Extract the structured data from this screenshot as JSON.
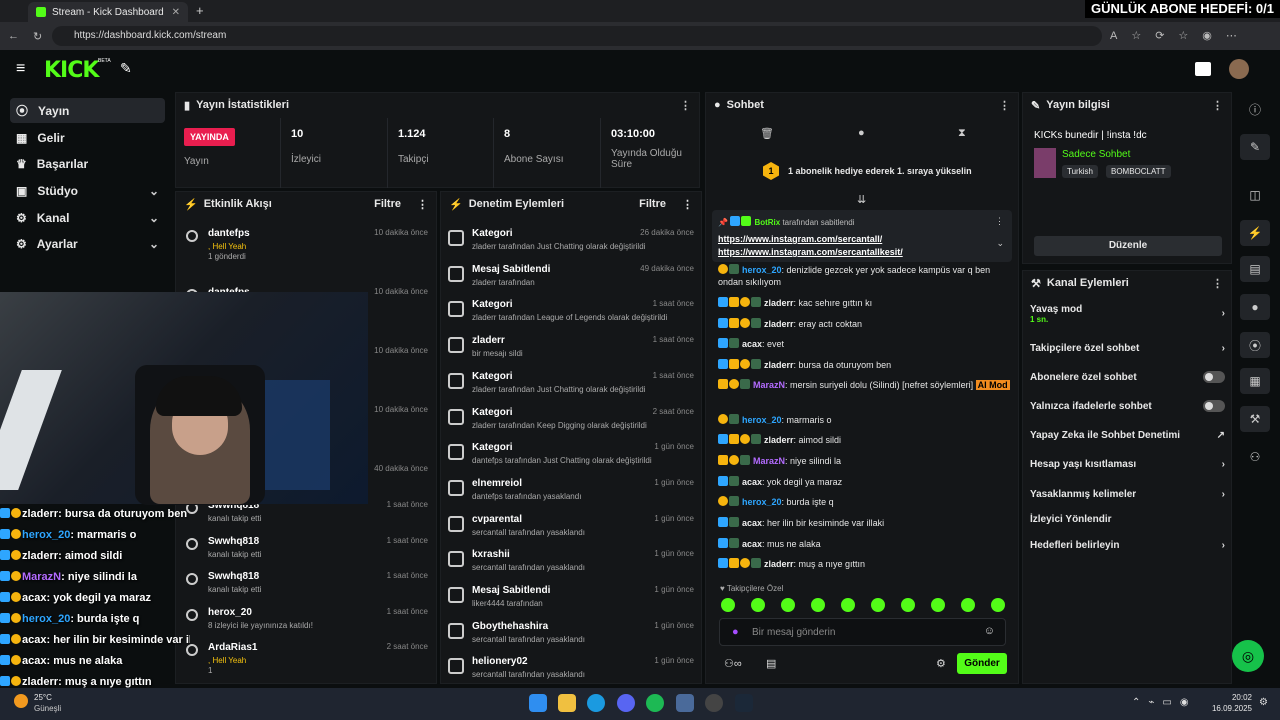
{
  "browser": {
    "tab_title": "Stream - Kick Dashboard",
    "url": "https://dashboard.kick.com/stream"
  },
  "overlay_goal": "GÜNLÜK ABONE HEDEFİ: 0/1",
  "brand": {
    "logo": "KICK",
    "beta": "BETA",
    "green": "#53fc18"
  },
  "sidebar": [
    {
      "label": "Yayın",
      "icon": "broadcast-icon"
    },
    {
      "label": "Gelir",
      "icon": "money-icon"
    },
    {
      "label": "Başarılar",
      "icon": "trophy-icon"
    },
    {
      "label": "Stüdyo",
      "icon": "studio-icon"
    },
    {
      "label": "Kanal",
      "icon": "gear-icon"
    },
    {
      "label": "Ayarlar",
      "icon": "gear-icon"
    }
  ],
  "stats": {
    "title": "Yayın İstatistikleri",
    "live_badge": "YAYINDA",
    "live_label": "Yayın",
    "cells": [
      {
        "value": "10",
        "label": "İzleyici"
      },
      {
        "value": "1.124",
        "label": "Takipçi"
      },
      {
        "value": "8",
        "label": "Abone Sayısı"
      },
      {
        "value": "03:10:00",
        "label": "Yayında Olduğu Süre"
      }
    ]
  },
  "activity": {
    "title": "Etkinlik Akışı",
    "filter": "Filtre",
    "items": [
      {
        "name": "dantefps",
        "sub": ", Hell Yeah",
        "extra": "1 gönderdi",
        "time": "10 dakika önce"
      },
      {
        "name": "dantefps",
        "sub": "",
        "extra": "",
        "time": "10 dakika önce"
      },
      {
        "name": "",
        "sub": "",
        "extra": "",
        "time": "10 dakika önce"
      },
      {
        "name": "",
        "sub": "",
        "extra": "",
        "time": "10 dakika önce"
      },
      {
        "name": "",
        "sub": "",
        "extra": "",
        "time": "40 dakika önce"
      },
      {
        "name": "Swwhq818",
        "sub": "kanalı takip etti",
        "extra": "",
        "time": "1 saat önce"
      },
      {
        "name": "Swwhq818",
        "sub": "kanalı takip etti",
        "extra": "",
        "time": "1 saat önce"
      },
      {
        "name": "Swwhq818",
        "sub": "kanalı takip etti",
        "extra": "",
        "time": "1 saat önce"
      },
      {
        "name": "herox_20",
        "sub": "8 izleyici ile yayınınıza katıldı!",
        "extra": "",
        "time": "1 saat önce"
      },
      {
        "name": "ArdaRias1",
        "sub": ", Hell Yeah",
        "extra": "1",
        "time": "2 saat önce"
      }
    ]
  },
  "moderation": {
    "title": "Denetim Eylemleri",
    "filter": "Filtre",
    "items": [
      {
        "title": "Kategori",
        "sub": "zladerr tarafından Just Chatting olarak değiştirildi",
        "time": "26 dakika önce"
      },
      {
        "title": "Mesaj Sabitlendi",
        "sub": "zladerr tarafından",
        "time": "49 dakika önce"
      },
      {
        "title": "Kategori",
        "sub": "zladerr tarafından League of Legends olarak değiştirildi",
        "time": "1 saat önce"
      },
      {
        "title": "zladerr",
        "sub": "bir mesajı sildi",
        "time": "1 saat önce"
      },
      {
        "title": "Kategori",
        "sub": "zladerr tarafından Just Chatting olarak değiştirildi",
        "time": "1 saat önce"
      },
      {
        "title": "Kategori",
        "sub": "zladerr tarafından Keep Digging olarak değiştirildi",
        "time": "2 saat önce"
      },
      {
        "title": "Kategori",
        "sub": "dantefps tarafından Just Chatting olarak değiştirildi",
        "time": "1 gün önce"
      },
      {
        "title": "elnemreiol",
        "sub": "dantefps tarafından yasaklandı",
        "time": "1 gün önce"
      },
      {
        "title": "cvparental",
        "sub": "sercantall tarafından yasaklandı",
        "time": "1 gün önce"
      },
      {
        "title": "kxrashii",
        "sub": "sercantall tarafından yasaklandı",
        "time": "1 gün önce"
      },
      {
        "title": "Mesaj Sabitlendi",
        "sub": "liker4444 tarafından",
        "time": "1 gün önce"
      },
      {
        "title": "Gboythehashira",
        "sub": "sercantall tarafından yasaklandı",
        "time": "1 gün önce"
      },
      {
        "title": "helionery02",
        "sub": "sercantall tarafından yasaklandı",
        "time": "1 gün önce"
      }
    ]
  },
  "chat": {
    "title": "Sohbet",
    "gift_banner": "1 abonelik hediye ederek 1. sıraya yükselin",
    "gift_count": "1",
    "pinned": {
      "by": "BotRix",
      "suffix": "tarafından sabitlendi",
      "links": [
        "https://www.instagram.com/sercantall/",
        "https://www.instagram.com/sercantallkesit/"
      ]
    },
    "messages": [
      {
        "user": "herox_20",
        "color": "#2ea6ff",
        "text": "denizlide gezcek yer yok sadece kampüs var q ben ondan sıkılıyom",
        "badges": [
          "sub"
        ]
      },
      {
        "user": "zladerr",
        "color": "#f0f0f0",
        "text": "kac sehıre gıttın kı",
        "badges": [
          "mod",
          "crown",
          "sub"
        ]
      },
      {
        "user": "zladerr",
        "color": "#f0f0f0",
        "text": "eray actı coktan",
        "badges": [
          "mod",
          "crown",
          "sub"
        ]
      },
      {
        "user": "acax",
        "color": "#f0f0f0",
        "text": "evet",
        "badges": [
          "mod"
        ]
      },
      {
        "user": "zladerr",
        "color": "#f0f0f0",
        "text": "bursa da oturuyom ben",
        "badges": [
          "mod",
          "crown",
          "sub"
        ]
      },
      {
        "user": "MarazN",
        "color": "#b36bff",
        "text": "mersin suriyeli dolu (Silindi) [nefret söylemleri]",
        "badges": [
          "crown",
          "sub"
        ],
        "automod": "AI Mod"
      },
      {
        "user": "herox_20",
        "color": "#2ea6ff",
        "text": "marmaris o",
        "badges": [
          "sub"
        ]
      },
      {
        "user": "zladerr",
        "color": "#f0f0f0",
        "text": "aimod sildi",
        "badges": [
          "mod",
          "crown",
          "sub"
        ]
      },
      {
        "user": "MarazN",
        "color": "#b36bff",
        "text": "niye silindi la",
        "badges": [
          "crown",
          "sub"
        ]
      },
      {
        "user": "acax",
        "color": "#f0f0f0",
        "text": "yok degil ya maraz",
        "badges": [
          "mod"
        ]
      },
      {
        "user": "herox_20",
        "color": "#2ea6ff",
        "text": "burda işte q",
        "badges": [
          "sub"
        ]
      },
      {
        "user": "acax",
        "color": "#f0f0f0",
        "text": "her ilin bir kesiminde var illaki",
        "badges": [
          "mod"
        ]
      },
      {
        "user": "acax",
        "color": "#f0f0f0",
        "text": "mus ne alaka",
        "badges": [
          "mod"
        ]
      },
      {
        "user": "zladerr",
        "color": "#f0f0f0",
        "text": "muş a nıye gıttın",
        "badges": [
          "mod",
          "crown",
          "sub"
        ]
      }
    ],
    "follower_label": "Takipçilere Özel",
    "input_placeholder": "Bir mesaj gönderin",
    "send": "Gönder"
  },
  "stream_info": {
    "title": "Yayın bilgisi",
    "stream_title": "KICKs bunedir | !insta !dc",
    "category": "Sadece Sohbet",
    "tags": [
      "Turkish",
      "BOMBOCLATT"
    ],
    "edit": "Düzenle"
  },
  "channel_actions": {
    "title": "Kanal Eylemleri",
    "slow_mode": "Yavaş mod",
    "slow_value": "1 sn.",
    "items": [
      {
        "label": "Takipçilere özel sohbet",
        "type": "arrow"
      },
      {
        "label": "Abonelere özel sohbet",
        "type": "toggle"
      },
      {
        "label": "Yalnızca ifadelerle sohbet",
        "type": "toggle"
      },
      {
        "label": "Yapay Zeka ile Sohbet Denetimi",
        "type": "ext"
      },
      {
        "label": "Hesap yaşı kısıtlaması",
        "type": "arrow"
      },
      {
        "label": "Yasaklanmış kelimeler",
        "type": "arrow"
      },
      {
        "label": "İzleyici Yönlendir",
        "type": "none"
      },
      {
        "label": "Hedefleri belirleyin",
        "type": "arrow"
      }
    ]
  },
  "overlay_chat": [
    {
      "user": "zladerr",
      "text": "bursa da oturuyom ben"
    },
    {
      "user": "herox_20",
      "text": "marmaris o"
    },
    {
      "user": "zladerr",
      "text": "aimod sildi"
    },
    {
      "user": "MarazN",
      "text": "niye silindi la"
    },
    {
      "user": "acax",
      "text": "yok degil ya maraz"
    },
    {
      "user": "herox_20",
      "text": "burda işte q"
    },
    {
      "user": "acax",
      "text": "her ilin bir kesiminde var illaki"
    },
    {
      "user": "acax",
      "text": "mus ne alaka"
    },
    {
      "user": "zladerr",
      "text": "muş a nıye gıttın"
    }
  ],
  "taskbar": {
    "weather_temp": "25°C",
    "weather_label": "Güneşli",
    "time": "20:02",
    "date": "16.09.2025"
  }
}
